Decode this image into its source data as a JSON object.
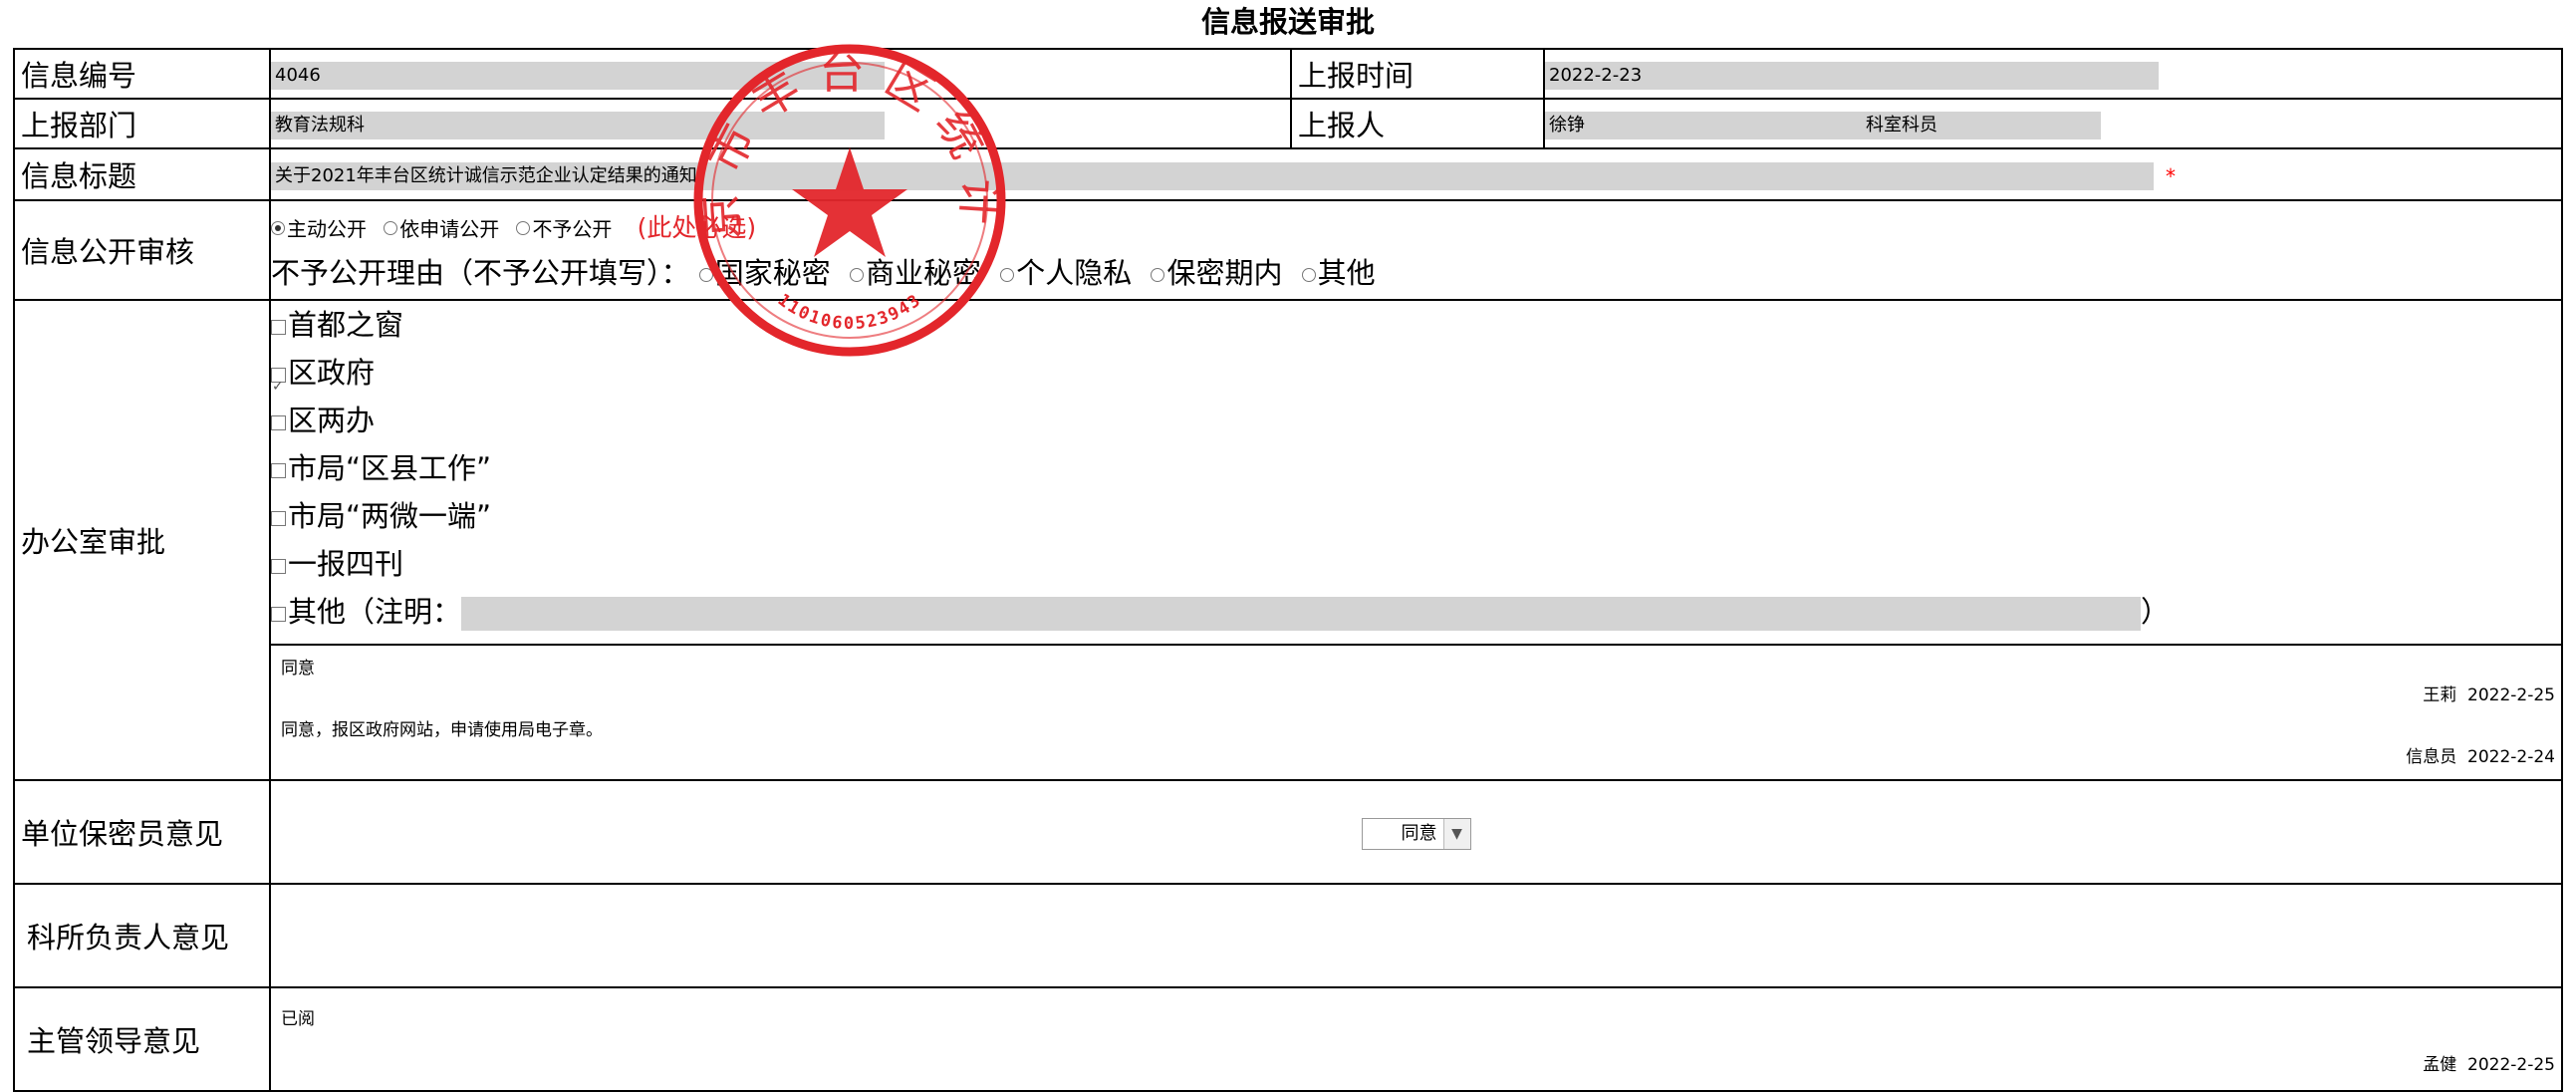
{
  "form": {
    "title": "信息报送审批",
    "info_no": {
      "label": "信息编号",
      "value": "4046"
    },
    "report_time": {
      "label": "上报时间",
      "value": "2022-2-23"
    },
    "report_dept": {
      "label": "上报部门",
      "value": "教育法规科"
    },
    "reporter": {
      "label": "上报人",
      "name": "徐铮",
      "role": "科室科员"
    },
    "info_title": {
      "label": "信息标题",
      "value": "关于2021年丰台区统计诚信示范企业认定结果的通知",
      "required_mark": "*"
    },
    "disclosure": {
      "label": "信息公开审核",
      "options": [
        {
          "label": "主动公开",
          "selected": true
        },
        {
          "label": "依申请公开",
          "selected": false
        },
        {
          "label": "不予公开",
          "selected": false
        }
      ],
      "required_note": "(此处必选)",
      "reason_label": "不予公开理由（不予公开填写）：",
      "reasons": [
        {
          "label": "国家秘密"
        },
        {
          "label": "商业秘密"
        },
        {
          "label": "个人隐私"
        },
        {
          "label": "保密期内"
        },
        {
          "label": "其他"
        }
      ]
    },
    "office": {
      "label": "办公室审批",
      "checkboxes": [
        {
          "label": "首都之窗",
          "checked": false
        },
        {
          "label": "区政府",
          "checked": true
        },
        {
          "label": "区两办",
          "checked": false
        },
        {
          "label": "市局“区县工作”",
          "checked": false
        },
        {
          "label": "市局“两微一端”",
          "checked": false
        },
        {
          "label": "一报四刊",
          "checked": false
        },
        {
          "label": "其他（注明：",
          "checked": false
        }
      ],
      "other_close": "）",
      "comments": [
        {
          "text": "同意",
          "signer": "王莉",
          "date": "2022-2-25"
        },
        {
          "text": "同意，报区政府网站，申请使用局电子章。",
          "signer": "信息员",
          "date": "2022-2-24"
        }
      ]
    },
    "secrecy": {
      "label": "单位保密员意见",
      "selected": "同意"
    },
    "dept_head": {
      "label": "科所负责人意见"
    },
    "leader": {
      "label": "主管领导意见",
      "comment": "已阅",
      "signer": "孟健",
      "date": "2022-2-25"
    }
  },
  "seal": {
    "color": "#e3262b",
    "text": "北京市丰台区统计局",
    "code": "1101060523943",
    "icon": "star-icon"
  }
}
